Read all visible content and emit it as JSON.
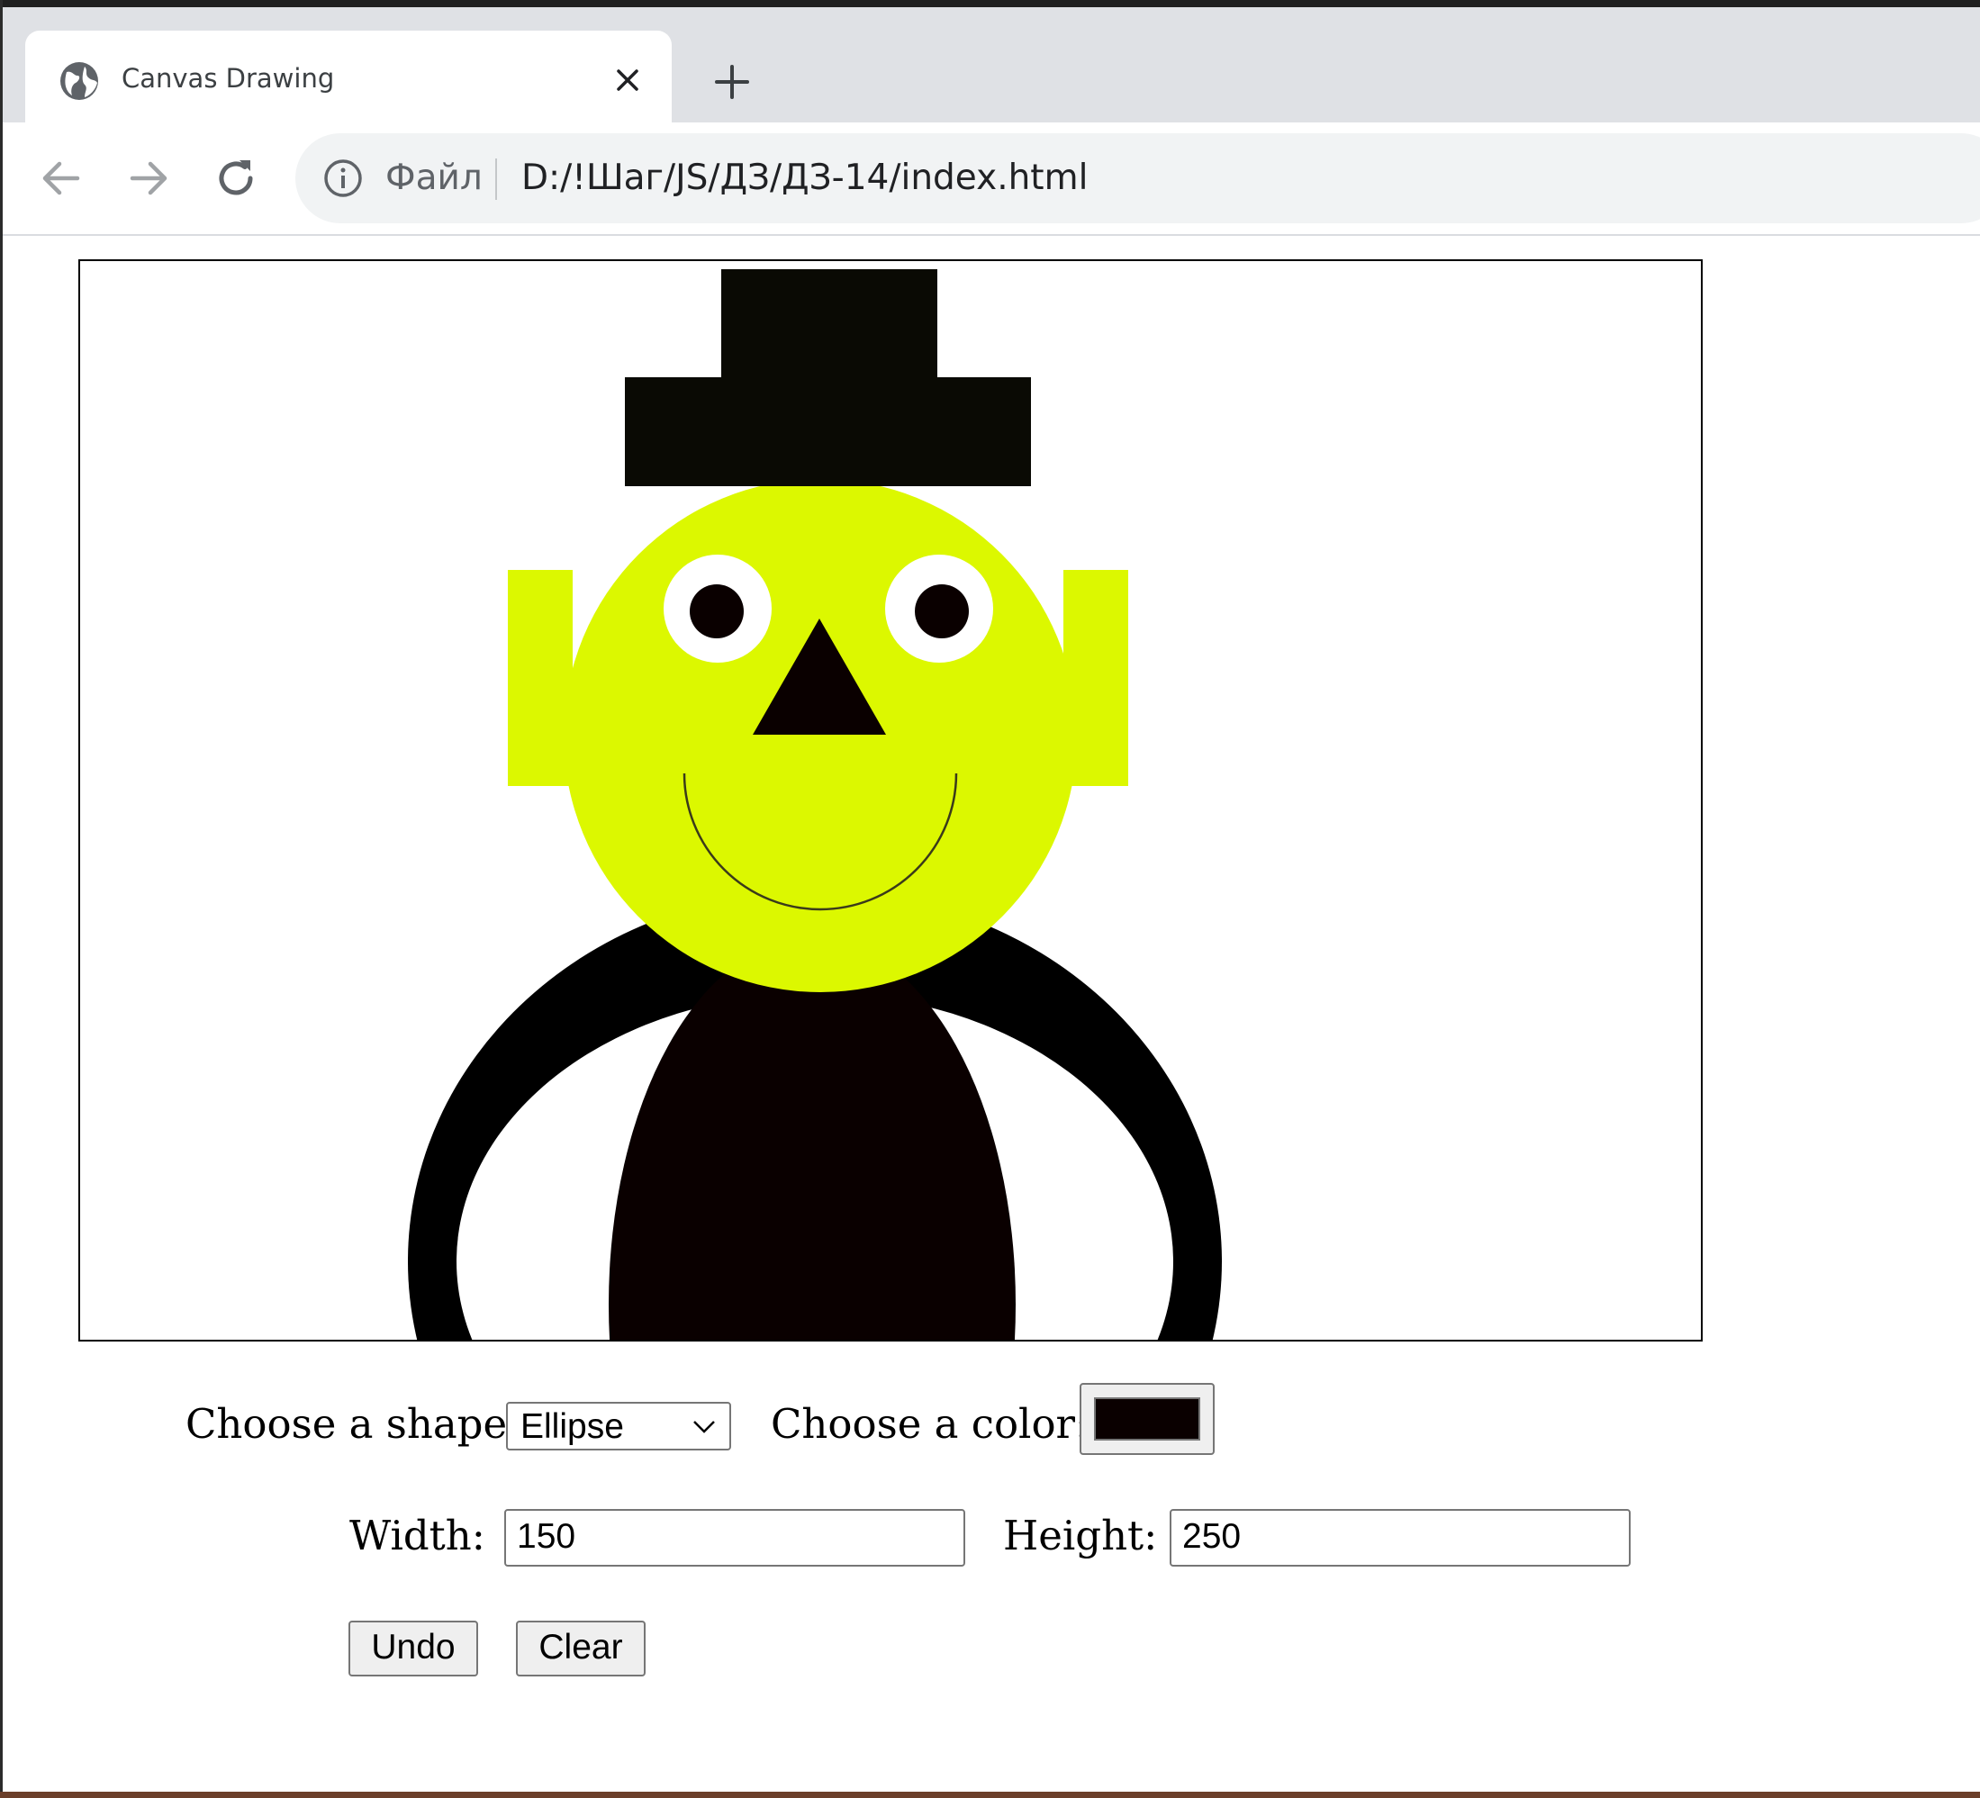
{
  "browser": {
    "tab_title": "Canvas Drawing",
    "address_scheme_label": "Файл",
    "url": "D:/!Шаг/JS/ДЗ/ДЗ-14/index.html",
    "icons": [
      "globe-icon",
      "close-icon",
      "plus-icon",
      "back-arrow-icon",
      "forward-arrow-icon",
      "reload-icon",
      "info-icon",
      "chevron-down-icon"
    ]
  },
  "canvas": {
    "colors": {
      "hat": "#0a0a04",
      "face": "#dcf800",
      "eye_white": "#ffffff",
      "pupil": "#0a0000",
      "nose": "#0a0000",
      "smile": "#3a3a1a",
      "arms": "#000000",
      "body": "#0a0000"
    }
  },
  "controls": {
    "shape_label": "Choose a shape:",
    "shape_value": "Ellipse",
    "color_label": "Choose a color:",
    "color_value": "#0a0000",
    "width_label": "Width:",
    "width_value": "150",
    "height_label": "Height:",
    "height_value": "250",
    "undo_label": "Undo",
    "clear_label": "Clear"
  }
}
